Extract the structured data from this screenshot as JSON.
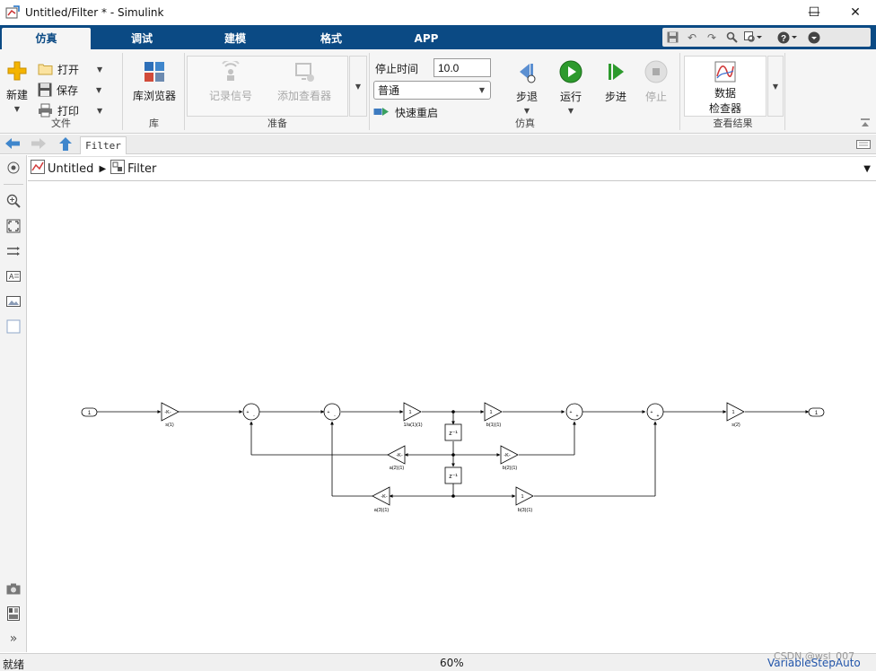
{
  "window": {
    "title": "Untitled/Filter * - Simulink",
    "controls": [
      "—",
      "☐",
      "✕"
    ]
  },
  "tabs": [
    {
      "label": "仿真",
      "active": true
    },
    {
      "label": "调试"
    },
    {
      "label": "建模"
    },
    {
      "label": "格式"
    },
    {
      "label": "APP"
    }
  ],
  "ribbon": {
    "file": {
      "new_label": "新建",
      "open_label": "打开",
      "save_label": "保存",
      "print_label": "打印",
      "section_label": "文件"
    },
    "library": {
      "browser_label": "库浏览器",
      "section_label": "库"
    },
    "prepare": {
      "log_signals_label": "记录信号",
      "add_viewer_label": "添加查看器",
      "section_label": "准备"
    },
    "simulate": {
      "stop_time_label": "停止时间",
      "stop_time_value": "10.0",
      "mode_value": "普通",
      "fast_restart_label": "快速重启",
      "step_back_label": "步退",
      "run_label": "运行",
      "step_forward_label": "步进",
      "stop_label": "停止",
      "section_label": "仿真"
    },
    "review": {
      "inspector_line1": "数据",
      "inspector_line2": "检查器",
      "section_label": "查看结果"
    }
  },
  "nav": {
    "tab_label": "Filter"
  },
  "breadcrumb": {
    "root": "Untitled",
    "child": "Filter"
  },
  "diagram": {
    "in_port": "1",
    "out_port": "1",
    "gain_in_text": "-K-",
    "gain_in_label": "s(1)",
    "gain_a1_text": "1",
    "gain_a1_label": "1/a(1)(1)",
    "gain_b1_text": "1",
    "gain_b1_label": "b(1)(1)",
    "gain_out_text": "1",
    "gain_out_label": "s(2)",
    "gain_a2_text": "-K-",
    "gain_a2_label": "a(2)(1)",
    "gain_b2_text": "-K-",
    "gain_b2_label": "b(2)(1)",
    "gain_a3_text": "-K-",
    "gain_a3_label": "a(3)(1)",
    "gain_b3_text": "1",
    "gain_b3_label": "b(3)(1)",
    "delay_text": "z⁻¹"
  },
  "status": {
    "left": "就绪",
    "zoom": "60%",
    "solver": "VariableStepAuto",
    "watermark": "CSDN @wsl_007"
  },
  "colors": {
    "tab_bar": "#0b4a84",
    "ribbon_bg": "#f5f5f5",
    "run_green": "#2d9a2d",
    "status_link": "#2255aa"
  }
}
